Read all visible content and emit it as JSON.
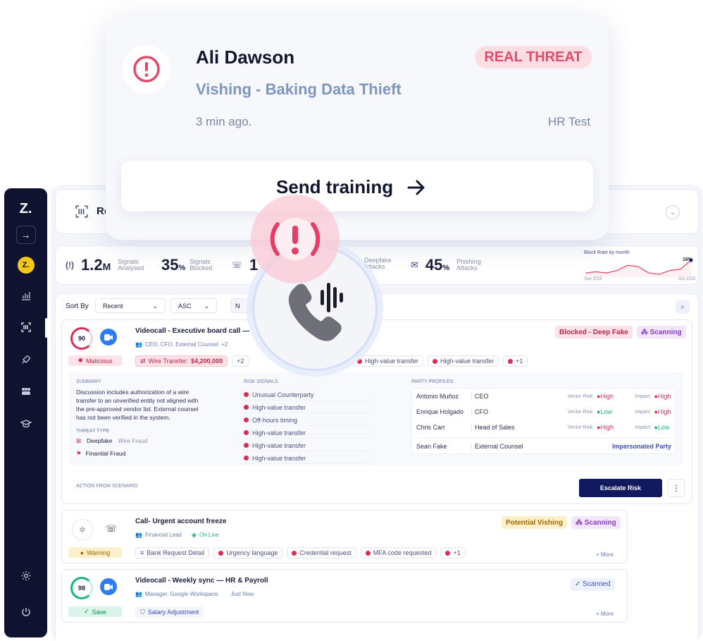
{
  "sidebar": {
    "logo": "Z.",
    "avatar": "Z."
  },
  "topbar": {
    "title": "Re"
  },
  "stats": [
    {
      "value": "1.2",
      "unit": "M",
      "label1": "Signals",
      "label2": "Analysed"
    },
    {
      "value": "35",
      "unit": "%",
      "label1": "Signals",
      "label2": "Blocked"
    },
    {
      "value": "1",
      "unit": "",
      "label1": "",
      "label2": ""
    },
    {
      "value": "",
      "unit": "",
      "label1": "Deepfake",
      "label2": "Attacks"
    },
    {
      "value": "45",
      "unit": "%",
      "label1": "Phishing",
      "label2": "Attacks"
    }
  ],
  "block_rate": {
    "title": "Block Rate by month",
    "current": "16%",
    "start": "Sep 2025",
    "end": "Oct 2025"
  },
  "chart_data": {
    "type": "line",
    "title": "Block Rate by month",
    "x": [
      "Sep 2025",
      "",
      "",
      "",
      "",
      "",
      "",
      "",
      "",
      "",
      "Oct 2025"
    ],
    "series": [
      {
        "values": [
          6,
          7,
          6,
          8,
          12,
          11,
          6,
          5,
          8,
          9,
          16
        ]
      }
    ]
  },
  "toolbar": {
    "sort_label": "Sort By",
    "sort_value": "Recent",
    "order_value": "ASC",
    "filter_label": "N"
  },
  "item1": {
    "score": "90",
    "title": "Videocall - Executive board call —",
    "participants": "CEO, CFO, External Counsel",
    "extra": "+2",
    "status_badge": "Malicious",
    "badge1": "Blocked - Deep Fake",
    "badge2": "Scanning",
    "wire_label": "Wire Transfer:",
    "wire_amount": "$4,200,000",
    "wire_extra": "+2",
    "chips": [
      "High-value transfer",
      "High-value transfer",
      "+1"
    ],
    "summary_h": "SUMMARY",
    "summary": "Discussion includes authorization of a wire transfer to an unverified entity not aligned with the pre-approved vendor list. External counsel has not been verified in the system.",
    "threat_h": "THREAT TYPE",
    "threat1": "Deepfake",
    "threat1b": "Wire Fraud",
    "threat2": "Finantial Fraud",
    "risk_h": "RISK SIGNALS",
    "risks": [
      "Unusual Counterparty",
      "High-value transfer",
      "Off-hours timing",
      "High-value transfer",
      "High-value transfer",
      "High-value transfer"
    ],
    "party_h": "PARTY PROFILES",
    "parties": [
      {
        "name": "Antonio Muñoz",
        "role": "CEO",
        "vr": "Vector Risk:",
        "vrv": "High",
        "im": "Impact:",
        "imv": "High"
      },
      {
        "name": "Enrique Holgado",
        "role": "CFO",
        "vr": "Vector Risk:",
        "vrv": "Low",
        "im": "Impact:",
        "imv": "High"
      },
      {
        "name": "Chris Carr",
        "role": "Head of Sales",
        "vr": "Vector Risk:",
        "vrv": "High",
        "im": "Impact:",
        "imv": "Low"
      },
      {
        "name": "Sean Fake",
        "role": "External Counsel",
        "tag": "Impersonated Party"
      }
    ],
    "action_h": "ACTION FROM SCENARIO",
    "escalate": "Escalate Risk"
  },
  "item2": {
    "title": "Call- Urgent account freeze",
    "participants": "Financial Lead",
    "live": "On Live",
    "status_badge": "Warning",
    "badge1": "Potential Vishing",
    "badge2": "Scanning",
    "chips": [
      "Bank Request Detail",
      "Urgency language",
      "Credential request",
      "MFA code requested",
      "+1"
    ],
    "more": "+ More"
  },
  "item3": {
    "score": "98",
    "title": "Videocall - Weekly sync — HR & Payroll",
    "participants": "Manager, Google Workspace",
    "time": "Just Now",
    "status_badge": "Save",
    "badge1": "Scanned",
    "chips": [
      "Salary Adjustment"
    ],
    "more": "+ More"
  },
  "notif": {
    "name": "Ali Dawson",
    "badge": "REAL THREAT",
    "subtitle": "Vishing - Baking Data Thieft",
    "time": "3 min ago.",
    "dept": "HR Test",
    "cta": "Send training"
  }
}
